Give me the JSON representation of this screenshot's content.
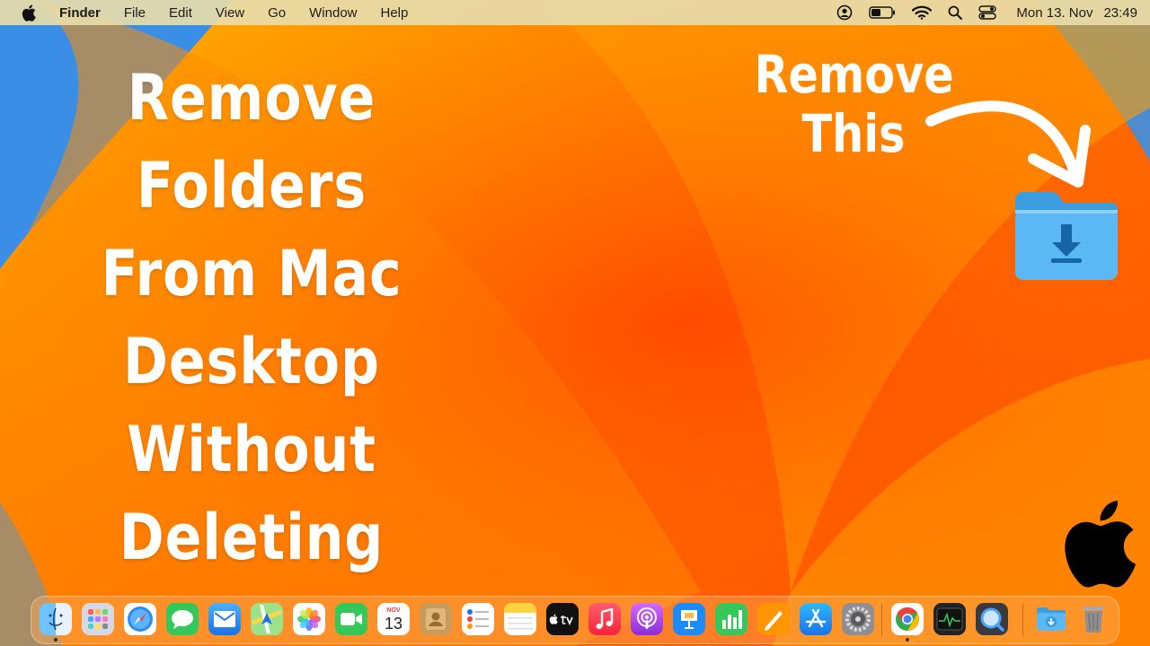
{
  "menubar": {
    "app_name": "Finder",
    "menus": [
      "File",
      "Edit",
      "View",
      "Go",
      "Window",
      "Help"
    ],
    "status_icons": [
      "user-account-icon",
      "battery-icon",
      "wifi-icon",
      "spotlight-search-icon",
      "control-center-icon"
    ],
    "date": "Mon 13. Nov",
    "time": "23:49"
  },
  "headline": {
    "lines": [
      "Remove",
      "Folders",
      "From Mac",
      "Desktop",
      "Without",
      "Deleting"
    ]
  },
  "callout": {
    "lines": [
      "Remove",
      "This"
    ]
  },
  "desktop": {
    "folder_icon": "downloads-folder-icon"
  },
  "dock": {
    "calendar_month": "NOV",
    "calendar_day": "13",
    "apps": [
      "finder",
      "launchpad",
      "safari",
      "messages",
      "mail",
      "maps",
      "photos",
      "facetime",
      "calendar",
      "contacts",
      "reminders",
      "notes",
      "apple-tv",
      "music",
      "podcasts",
      "keynote",
      "numbers",
      "pages",
      "app-store",
      "system-settings",
      "chrome",
      "activity-monitor",
      "quicktime",
      "downloads",
      "trash"
    ]
  },
  "colors": {
    "wallpaper_orange": "#ff6a00",
    "wallpaper_yellow": "#ffb300",
    "wallpaper_blue": "#3a8ee6",
    "headline": "#ffffff"
  }
}
